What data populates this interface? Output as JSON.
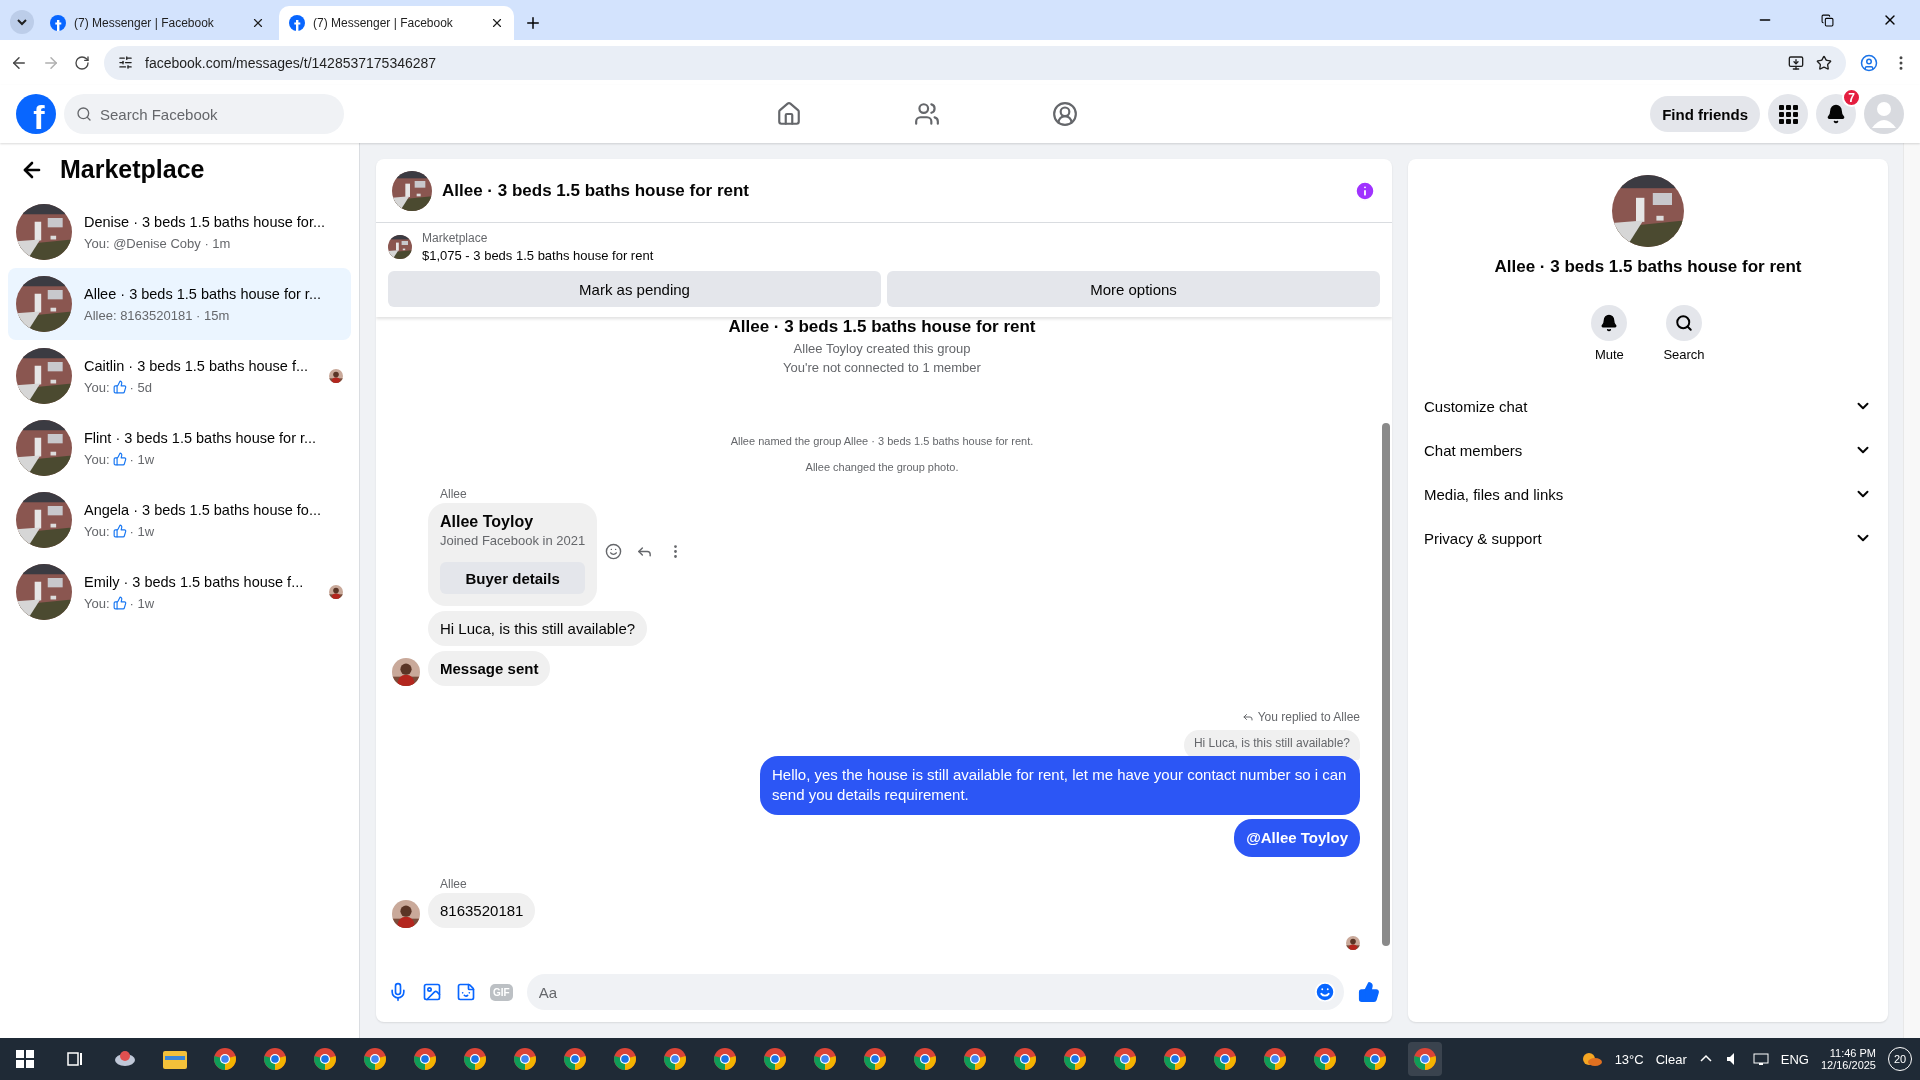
{
  "browser": {
    "tabs": [
      {
        "title": "(7) Messenger | Facebook",
        "selected": false
      },
      {
        "title": "(7) Messenger | Facebook",
        "selected": true
      }
    ],
    "url": "facebook.com/messages/t/1428537175346287"
  },
  "header": {
    "logo": "f",
    "search": {
      "placeholder": "Search Facebook"
    },
    "find_friends": "Find friends",
    "notification_count": "7"
  },
  "sidebar": {
    "title": "Marketplace",
    "conversations": [
      {
        "title": "Denise · 3 beds 1.5 baths house for...",
        "kind": "text",
        "preview": "You: @Denise Coby · 1m",
        "selected": false,
        "seen": false
      },
      {
        "title": "Allee · 3 beds 1.5 baths house for r...",
        "kind": "text",
        "preview": "Allee: 8163520181 · 15m",
        "selected": true,
        "seen": false
      },
      {
        "title": "Caitlin · 3 beds 1.5 baths house f...",
        "kind": "like",
        "preview": "You:",
        "time": "· 5d",
        "selected": false,
        "seen": true
      },
      {
        "title": "Flint · 3 beds 1.5 baths house for r...",
        "kind": "like",
        "preview": "You:",
        "time": "· 1w",
        "selected": false,
        "seen": false
      },
      {
        "title": "Angela · 3 beds 1.5 baths house fo...",
        "kind": "like",
        "preview": "You:",
        "time": "· 1w",
        "selected": false,
        "seen": false
      },
      {
        "title": "Emily · 3 beds 1.5 baths house f...",
        "kind": "like",
        "preview": "You:",
        "time": "· 1w",
        "selected": false,
        "seen": true
      }
    ]
  },
  "chat": {
    "title": "Allee · 3 beds 1.5 baths house for rent",
    "listing": {
      "label": "Marketplace",
      "title": "$1,075 - 3 beds 1.5 baths house for rent",
      "buttons": [
        "Mark as pending",
        "More options"
      ]
    },
    "messages": [
      {
        "kind": "heading",
        "text": "Allee · 3 beds 1.5 baths house for rent"
      },
      {
        "kind": "system",
        "text": "Allee Toyloy created this group"
      },
      {
        "kind": "system",
        "text": "You're not connected to 1 member"
      },
      {
        "kind": "notice",
        "text": "Allee named the group Allee · 3 beds 1.5 baths house for rent."
      },
      {
        "kind": "notice",
        "text": "Allee changed the group photo."
      },
      {
        "kind": "sender",
        "text": "Allee"
      },
      {
        "kind": "card",
        "title": "Allee Toyloy",
        "subtitle": "Joined Facebook in 2021",
        "button": "Buyer details"
      },
      {
        "kind": "incoming",
        "text": "Hi Luca, is this still available?",
        "avatar": false,
        "bold": false
      },
      {
        "kind": "incoming",
        "text": "Message sent",
        "avatar": true,
        "bold": true
      },
      {
        "kind": "reply_note",
        "text": "You replied to Allee"
      },
      {
        "kind": "quoted",
        "text": "Hi Luca, is this still available?"
      },
      {
        "kind": "outgoing",
        "text": "Hello, yes the house is still available for rent, let me have your contact number so i can send you details requirement.",
        "bold": false
      },
      {
        "kind": "outgoing",
        "text": "@Allee Toyloy",
        "bold": true
      },
      {
        "kind": "sender",
        "text": "Allee"
      },
      {
        "kind": "incoming",
        "text": "8163520181",
        "avatar": true,
        "bold": false
      }
    ],
    "seen": true,
    "composer": {
      "gif": "GIF",
      "placeholder": "Aa"
    }
  },
  "details": {
    "title": "Allee · 3 beds 1.5 baths house for rent",
    "actions": [
      {
        "kind": "bell",
        "label": "Mute"
      },
      {
        "kind": "search",
        "label": "Search"
      }
    ],
    "sections": [
      "Customize chat",
      "Chat members",
      "Media, files and links",
      "Privacy & support"
    ]
  },
  "taskbar": {
    "temperature": "13°C",
    "weather": "Clear",
    "language": "ENG",
    "time": "11:46 PM",
    "date": "12/16/2025",
    "notifications": "20"
  }
}
